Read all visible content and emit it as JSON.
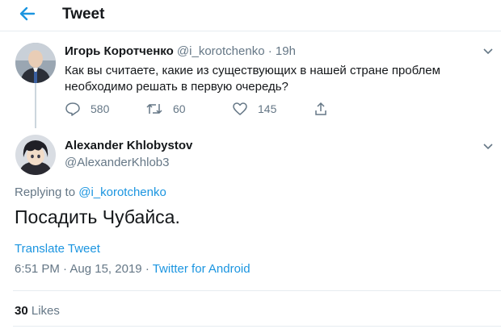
{
  "header": {
    "title": "Tweet",
    "back_icon": "arrow-left-icon"
  },
  "parent_tweet": {
    "author_name": "Игорь Коротченко",
    "author_handle": "@i_korotchenko",
    "separator": "·",
    "time": "19h",
    "text": "Как вы считаете, какие из существующих в нашей стране проблем необходимо решать в первую очередь?",
    "actions": {
      "replies": "580",
      "retweets": "60",
      "likes": "145"
    }
  },
  "main_tweet": {
    "author_name": "Alexander Khlobystov",
    "author_handle": "@AlexanderKhlob3",
    "replying_prefix": "Replying to",
    "replying_to": "@i_korotchenko",
    "text": "Посадить Чубайса.",
    "translate_label": "Translate Tweet",
    "time": "6:51 PM",
    "date_separator": "·",
    "date": "Aug 15, 2019",
    "source_separator": "·",
    "source": "Twitter for Android",
    "likes_count": "30",
    "likes_label": "Likes"
  },
  "colors": {
    "accent": "#1b95e0",
    "muted": "#657786",
    "text": "#14171a",
    "divider": "#e6ecf0"
  }
}
